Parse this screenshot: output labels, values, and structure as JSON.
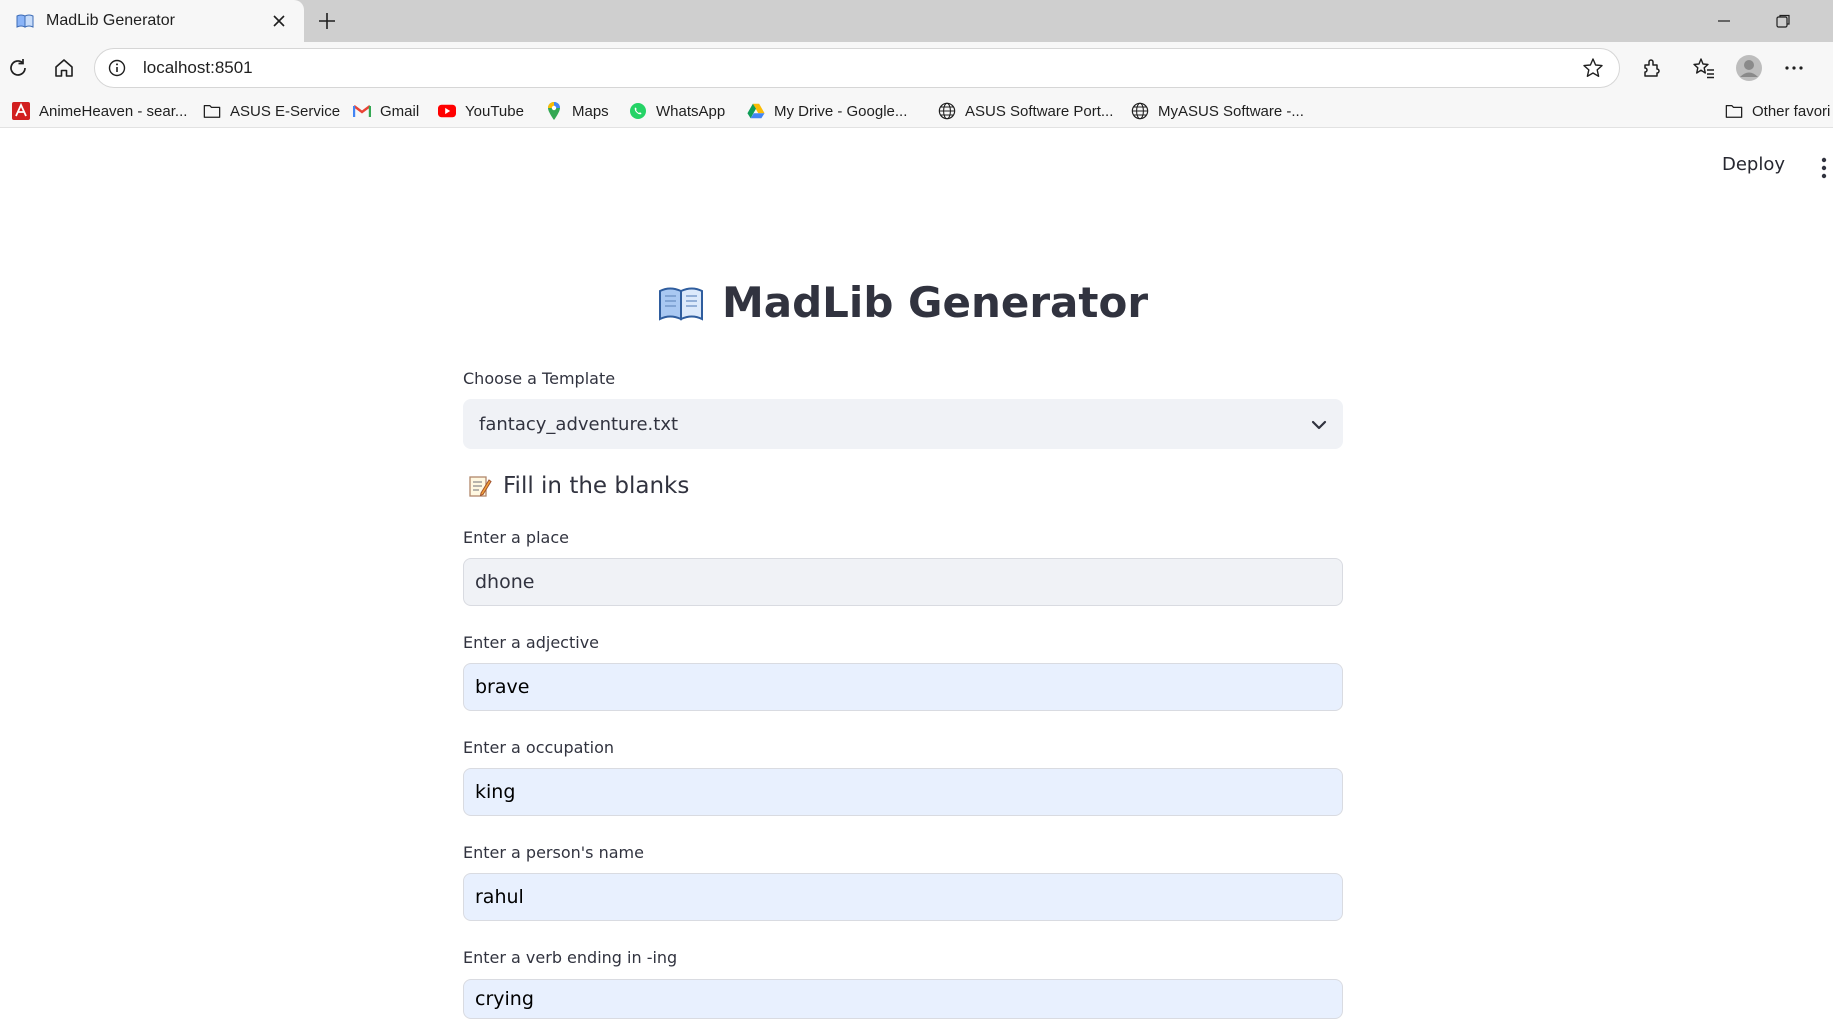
{
  "browser": {
    "tab_title": "MadLib Generator",
    "url": "localhost:8501",
    "bookmarks": [
      {
        "label": "AnimeHeaven - sear...",
        "icon": "animeheaven-icon"
      },
      {
        "label": "ASUS E-Service",
        "icon": "folder-icon"
      },
      {
        "label": "Gmail",
        "icon": "gmail-icon"
      },
      {
        "label": "YouTube",
        "icon": "youtube-icon"
      },
      {
        "label": "Maps",
        "icon": "maps-icon"
      },
      {
        "label": "WhatsApp",
        "icon": "whatsapp-icon"
      },
      {
        "label": "My Drive - Google...",
        "icon": "drive-icon"
      },
      {
        "label": "ASUS Software Port...",
        "icon": "globe-icon"
      },
      {
        "label": "MyASUS Software -...",
        "icon": "globe-icon"
      }
    ],
    "other_favorites": "Other favori"
  },
  "app": {
    "deploy_label": "Deploy",
    "title": "MadLib Generator",
    "template_label": "Choose a Template",
    "template_value": "fantacy_adventure.txt",
    "section_header": "Fill in the blanks",
    "fields": [
      {
        "label": "Enter a place",
        "value": "dhone"
      },
      {
        "label": "Enter a adjective",
        "value": "brave"
      },
      {
        "label": "Enter a occupation",
        "value": "king"
      },
      {
        "label": "Enter a person's name",
        "value": "rahul"
      },
      {
        "label": "Enter a verb ending in -ing",
        "value": "crying"
      }
    ]
  },
  "colors": {
    "streamlit_text": "#31333f",
    "input_grey": "#f0f2f6",
    "input_blue": "#e8f0fe"
  }
}
